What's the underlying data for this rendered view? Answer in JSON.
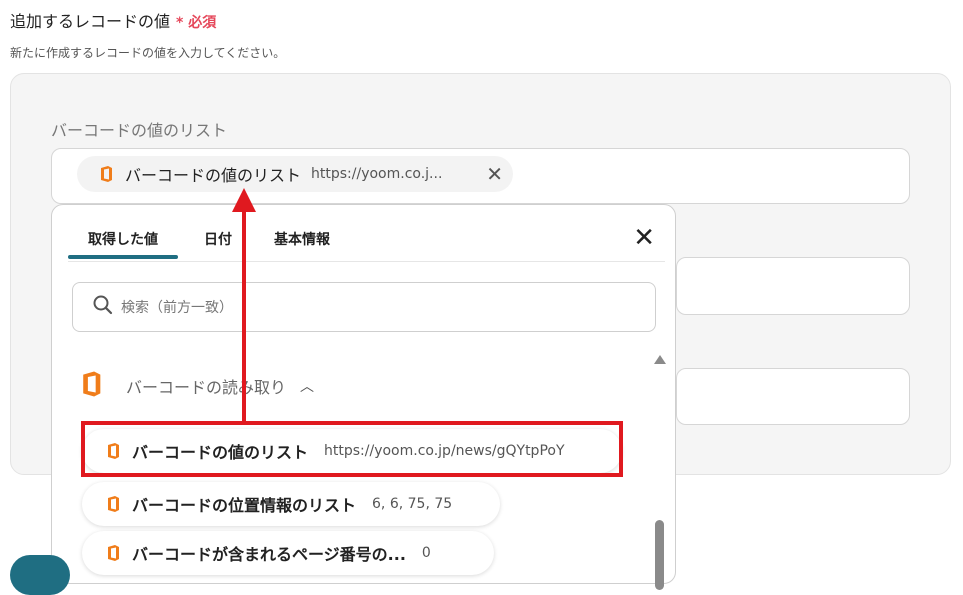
{
  "section": {
    "title": "追加するレコードの値",
    "required_mark": "* 必須",
    "description": "新たに作成するレコードの値を入力してください。"
  },
  "field": {
    "label": "バーコードの値のリスト",
    "chip_label": "バーコードの値のリスト",
    "chip_value": "https://yoom.co.j..."
  },
  "dropdown": {
    "tabs": [
      "取得した値",
      "日付",
      "基本情報"
    ],
    "search_placeholder": "検索（前方一致）",
    "group_label": "バーコードの読み取り",
    "items": [
      {
        "label": "バーコードの値のリスト",
        "value": "https://yoom.co.jp/news/gQYtpPoY"
      },
      {
        "label": "バーコードの位置情報のリスト",
        "value": "6, 6, 75, 75"
      },
      {
        "label": "バーコードが含まれるページ番号の...",
        "value": "0"
      }
    ]
  },
  "colors": {
    "accent": "#1f6e82",
    "required": "#e5475a",
    "annotation": "#e0191f",
    "icon_orange": "#f07d1a"
  }
}
